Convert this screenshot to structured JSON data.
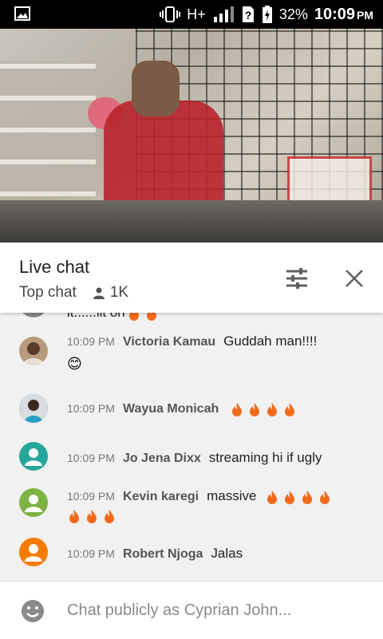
{
  "status_bar": {
    "network": "H+",
    "battery": "32%",
    "time": "10:09",
    "ampm": "PM"
  },
  "chat_header": {
    "title": "Live chat",
    "mode": "Top chat",
    "viewers": "1K"
  },
  "partial_message": "it......lit on",
  "messages": [
    {
      "time": "10:09 PM",
      "author": "Victoria Kamau",
      "text": "Guddah man!!!!",
      "second_line": "😊",
      "avatar_color": "#b89a7c"
    },
    {
      "time": "10:09 PM",
      "author": "Wayua Monicah",
      "text": "",
      "fires": 4,
      "avatar_color": "#4a5560"
    },
    {
      "time": "10:09 PM",
      "author": "Jo Jena Dixx",
      "text": "streaming hi if ugly",
      "avatar_color": "#26a69a"
    },
    {
      "time": "10:09 PM",
      "author": "Kevin karegi",
      "text": "massive",
      "fires": 4,
      "second_line_fires": 3,
      "avatar_color": "#7cb342"
    },
    {
      "time": "10:09 PM",
      "author": "Robert Njoga",
      "text": "Jalas",
      "avatar_color": "#f57c00"
    }
  ],
  "input": {
    "placeholder": "Chat publicly as Cyprian John..."
  },
  "colors": {
    "accent_red": "#e22222",
    "fire": "#f26b1d"
  }
}
